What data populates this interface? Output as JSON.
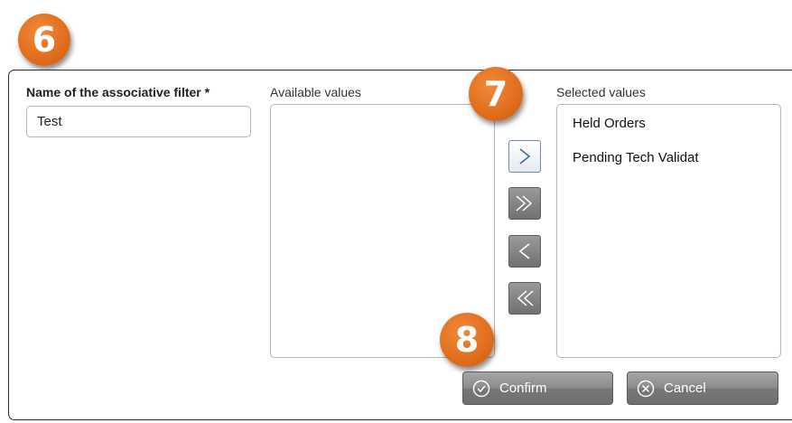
{
  "badges": {
    "b6": "6",
    "b7": "7",
    "b8": "8"
  },
  "filter": {
    "name_label": "Name of the associative filter *",
    "name_value": "Test"
  },
  "available": {
    "label": "Available values",
    "items": []
  },
  "selected": {
    "label": "Selected values",
    "items": [
      "Held Orders",
      "Pending Tech Validat"
    ]
  },
  "transfer_buttons": [
    "add-selected",
    "add-all",
    "remove-selected",
    "remove-all"
  ],
  "actions": {
    "confirm": "Confirm",
    "cancel": "Cancel"
  },
  "colors": {
    "badge": "#e06d1c",
    "button_gray": "#8a8a8a",
    "active_border": "#6c8bb4"
  }
}
